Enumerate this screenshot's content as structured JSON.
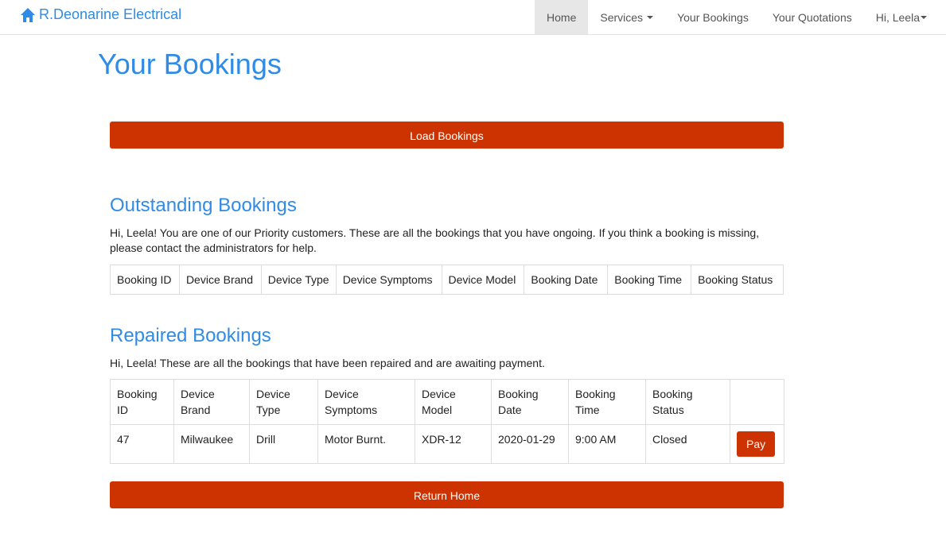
{
  "brand": {
    "name": "R.Deonarine Electrical",
    "icon": "home-icon",
    "color": "#2f8be6"
  },
  "nav": {
    "items": [
      {
        "label": "Home",
        "active": true
      },
      {
        "label": "Services",
        "dropdown": true
      },
      {
        "label": "Your Bookings"
      },
      {
        "label": "Your Quotations"
      },
      {
        "label": "Hi, Leela",
        "dropdown": true
      }
    ]
  },
  "page": {
    "title": "Your Bookings"
  },
  "buttons": {
    "load": "Load Bookings",
    "return_home": "Return Home",
    "accent": "#cc3300"
  },
  "outstanding": {
    "title": "Outstanding Bookings",
    "text": "Hi, Leela! You are one of our Priority customers. These are all the bookings that you have ongoing. If you think a booking is missing, please contact the administrators for help.",
    "headers": [
      "Booking ID",
      "Device Brand",
      "Device Type",
      "Device Symptoms",
      "Device Model",
      "Booking Date",
      "Booking Time",
      "Booking Status"
    ],
    "rows": []
  },
  "repaired": {
    "title": "Repaired Bookings",
    "text": "Hi, Leela! These are all the bookings that have been repaired and are awaiting payment.",
    "headers": [
      "Booking ID",
      "Device Brand",
      "Device Type",
      "Device Symptoms",
      "Device Model",
      "Booking Date",
      "Booking Time",
      "Booking Status"
    ],
    "rows": [
      {
        "cells": [
          "47",
          "Milwaukee",
          "Drill",
          "Motor Burnt.",
          "XDR-12",
          "2020-01-29",
          "9:00 AM",
          "Closed"
        ],
        "action": "Pay"
      }
    ]
  }
}
